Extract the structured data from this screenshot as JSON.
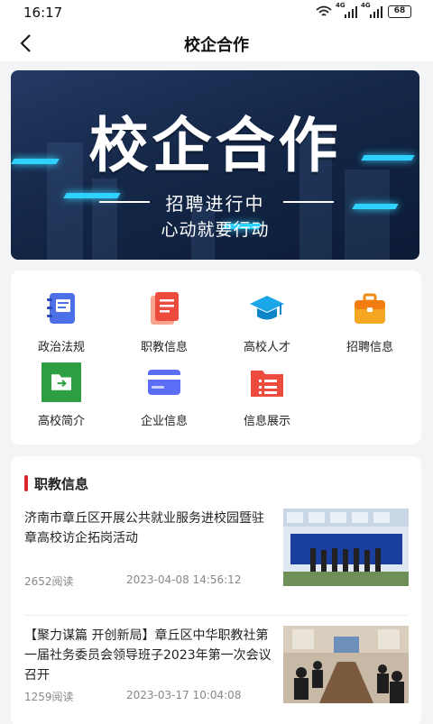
{
  "status": {
    "time": "16:17",
    "battery": "68",
    "net1": "4G",
    "net2": "4G"
  },
  "nav": {
    "title": "校企合作"
  },
  "banner": {
    "title": "校企合作",
    "subtitle": "招聘进行中",
    "tagline": "心动就要行动"
  },
  "menu": [
    {
      "label": "政治法规",
      "icon": "notebook-icon"
    },
    {
      "label": "职教信息",
      "icon": "document-icon"
    },
    {
      "label": "高校人才",
      "icon": "graduation-cap-icon"
    },
    {
      "label": "招聘信息",
      "icon": "briefcase-icon"
    },
    {
      "label": "高校简介",
      "icon": "folder-icon"
    },
    {
      "label": "企业信息",
      "icon": "card-icon"
    },
    {
      "label": "信息展示",
      "icon": "folder-list-icon"
    }
  ],
  "news": {
    "section_title": "职教信息",
    "items": [
      {
        "title": "济南市章丘区开展公共就业服务进校园暨驻章高校访企拓岗活动",
        "reads": "2652阅读",
        "date": "2023-04-08 14:56:12"
      },
      {
        "title": "【聚力谋篇 开创新局】章丘区中华职教社第一届社务委员会领导班子2023年第一次会议召开",
        "reads": "1259阅读",
        "date": "2023-03-17 10:04:08"
      }
    ]
  }
}
